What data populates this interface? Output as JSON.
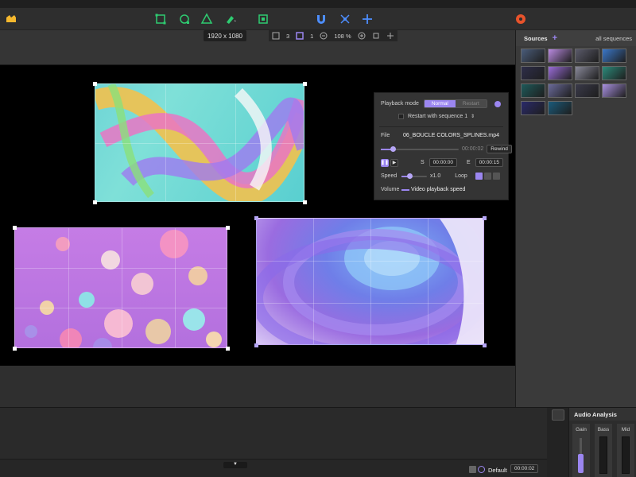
{
  "toolbar": {
    "icons": [
      "app-logo-icon",
      "rectangle-tool-icon",
      "circle-tool-icon",
      "triangle-tool-icon",
      "paint-tool-icon",
      "frame-tool-icon",
      "magnet-icon",
      "transform-icon",
      "add-point-icon",
      "settings-icon"
    ]
  },
  "canvas_info": {
    "resolution": "1920 x 1080",
    "grid_count": "3",
    "page": "1",
    "zoom": "108 %"
  },
  "playback": {
    "mode_label": "Playback mode",
    "mode_normal": "Normal",
    "mode_restart": "Restart",
    "restart_with_label": "Restart with sequence 1",
    "file_label": "File",
    "file_name": "06_BOUCLE COLORS_SPLINES.mp4",
    "current_time": "00:00:02",
    "rewind_label": "Rewind",
    "start_label": "S",
    "start_time": "00:00:00",
    "end_label": "E",
    "end_time": "00:00:15",
    "speed_label": "Speed",
    "speed_value": "x1.0",
    "loop_label": "Loop",
    "volume_label": "Volume",
    "volume_desc": "Video playback speed",
    "progress": 0.15,
    "speed_fill": 0.3
  },
  "sources": {
    "title": "Sources",
    "filter": "all sequences",
    "thumbs": [
      {
        "color": "#4a5c7a"
      },
      {
        "color": "#b98ae0"
      },
      {
        "color": "#5a5a6a"
      },
      {
        "color": "#3a77c8"
      },
      {
        "color": "#2e2e4a"
      },
      {
        "color": "#9a6cd8"
      },
      {
        "color": "#888899"
      },
      {
        "color": "#2c8a7a"
      },
      {
        "color": "#1e5a5a"
      },
      {
        "color": "#6a6a9a"
      },
      {
        "color": "#3a3a4a"
      },
      {
        "color": "#a890e0"
      },
      {
        "color": "#2a2a6a"
      },
      {
        "color": "#1a5a7a"
      }
    ]
  },
  "status": {
    "default_label": "Default",
    "time": "00:00:02"
  },
  "audio": {
    "title": "Audio Analysis",
    "gain": "Gain",
    "bass": "Bass",
    "mid": "Mid"
  }
}
